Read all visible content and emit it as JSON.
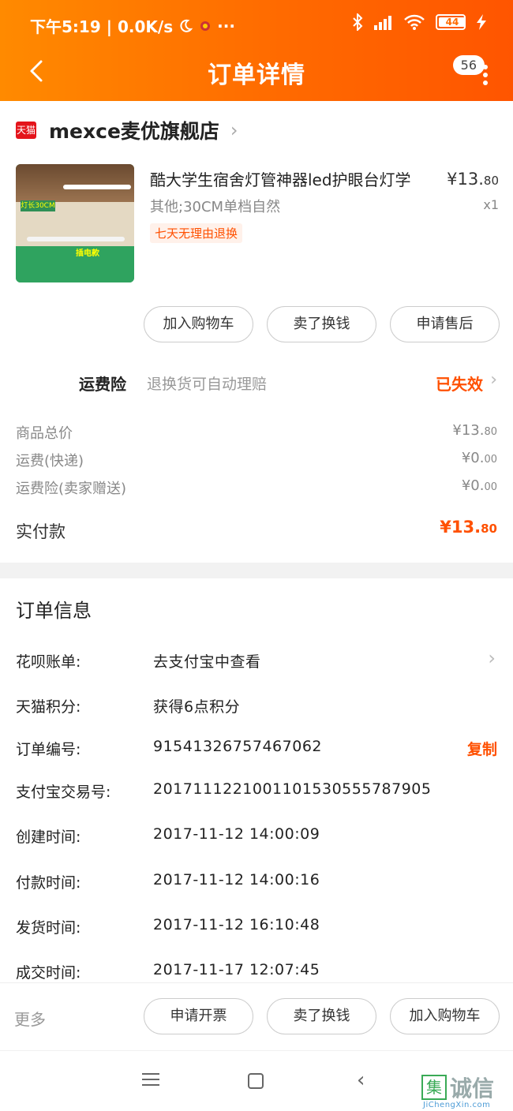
{
  "status_bar": {
    "time_speed": "下午5:19 | 0.0K/s",
    "moon_icon": "moon-icon",
    "dots": "···",
    "battery": "44"
  },
  "header": {
    "title": "订单详情",
    "badge_count": "56"
  },
  "shop": {
    "badge": "天猫",
    "name": "mexce麦优旗舰店",
    "chevron": "›"
  },
  "product": {
    "image_tag": "灯长30CM",
    "image_label": "插电款",
    "title": "酷大学生宿舍灯管神器led护眼台灯学",
    "price_main": "¥13.",
    "price_decimal": "80",
    "sku": "其他;30CM单档自然",
    "qty": "x1",
    "return_tag": "七天无理由退换"
  },
  "item_actions": [
    "加入购物车",
    "卖了换钱",
    "申请售后"
  ],
  "insurance": {
    "label": "运费险",
    "desc": "退换货可自动理赔",
    "status": "已失效",
    "chevron": "›"
  },
  "costs": [
    {
      "label": "商品总价",
      "main": "¥13.",
      "decimal": "80"
    },
    {
      "label": "运费(快递)",
      "main": "¥0.",
      "decimal": "00"
    },
    {
      "label": "运费险(卖家赠送)",
      "main": "¥0.",
      "decimal": "00"
    }
  ],
  "paid": {
    "label": "实付款",
    "main": "¥13.",
    "decimal": "80"
  },
  "order_info": {
    "title": "订单信息",
    "rows": [
      {
        "label": "花呗账单:",
        "value": "去支付宝中查看"
      },
      {
        "label": "天猫积分:",
        "value": "获得6点积分"
      },
      {
        "label": "订单编号:",
        "value": "91541326757467062"
      },
      {
        "label": "支付宝交易号:",
        "value": "2017111221001101530555787905"
      },
      {
        "label": "创建时间:",
        "value": "2017-11-12 14:00:09"
      },
      {
        "label": "付款时间:",
        "value": "2017-11-12 14:00:16"
      },
      {
        "label": "发货时间:",
        "value": "2017-11-12 16:10:48"
      },
      {
        "label": "成交时间:",
        "value": "2017-11-17 12:07:45"
      }
    ],
    "copy_label": "复制",
    "chevron": "›"
  },
  "bottom_bar": {
    "more_label": "更多",
    "buttons": [
      "申请开票",
      "卖了换钱",
      "加入购物车"
    ]
  },
  "nav": {
    "back_glyph": "‹"
  },
  "watermark": {
    "icon_char": "集",
    "text": "诚信",
    "url": "JiChengXin.com"
  },
  "colors": {
    "header_gradient_start": "#ff8a00",
    "header_gradient_end": "#ff5500",
    "accent": "#ff5000"
  }
}
